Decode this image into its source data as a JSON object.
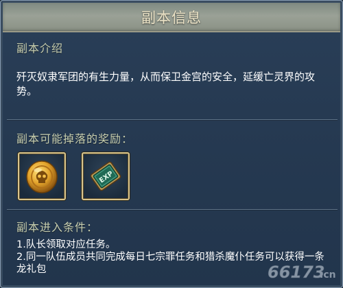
{
  "dialog": {
    "title": "副本信息"
  },
  "intro": {
    "heading": "副本介绍",
    "text": "歼灭奴隶军团的有生力量，从而保卫金宫的安全，延缓亡灵界的攻势。"
  },
  "rewards": {
    "heading": "副本可能掉落的奖励：",
    "items": [
      {
        "icon": "gold-skull-coin-icon"
      },
      {
        "icon": "exp-card-icon",
        "label": "EXP"
      }
    ]
  },
  "requirements": {
    "heading": "副本进入条件：",
    "lines": [
      "1.队长领取对应任务。",
      "2.同一队伍成员共同完成每日七宗罪任务和猎杀魔仆任务可以获得一条龙礼包"
    ]
  },
  "watermark": {
    "text": "66173",
    "suffix": ".cn"
  },
  "colors": {
    "panel_bg": "#263a52",
    "header_bg": "#9aa196",
    "title_text": "#ece3c6",
    "section_text": "#c8cfb0",
    "slot_border": "#d8c58e"
  }
}
